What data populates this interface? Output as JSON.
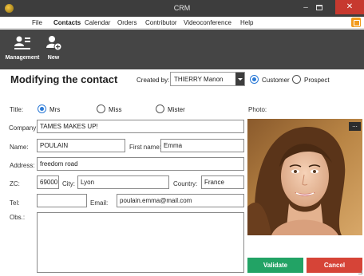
{
  "window": {
    "title": "CRM",
    "minimize_glyph": "–",
    "close_glyph": "✕"
  },
  "menu": {
    "items": [
      "File",
      "Contacts",
      "Calendar",
      "Orders",
      "Contributor",
      "Videoconference",
      "Help"
    ],
    "active": "Contacts"
  },
  "ribbon": {
    "management_label": "Management",
    "new_label": "New"
  },
  "header": {
    "title": "Modifying the contact",
    "created_by_label": "Created by:",
    "created_by_value": "THIERRY Manon",
    "customer_label": "Customer",
    "prospect_label": "Prospect",
    "type_selected": "Customer"
  },
  "form": {
    "title_label": "Title:",
    "title_options": [
      "Mrs",
      "Miss",
      "Mister"
    ],
    "title_selected": "Mrs",
    "photo_label": "Photo:",
    "photo_menu": "...",
    "company_label": "Company:",
    "company": "TAMES MAKES UP!",
    "name_label": "Name:",
    "name": "POULAIN",
    "first_name_label": "First name:",
    "first_name": "Emma",
    "address_label": "Address:",
    "address": "freedom road",
    "zc_label": "ZC:",
    "zc": "69000",
    "city_label": "City:",
    "city": "Lyon",
    "country_label": "Country:",
    "country": "France",
    "tel_label": "Tel:",
    "tel": "",
    "email_label": "Email:",
    "email": "poulain.emma@mail.com",
    "obs_label": "Obs.:",
    "obs": ""
  },
  "actions": {
    "validate": "Validate",
    "cancel": "Cancel"
  },
  "colors": {
    "titlebar": "#3d3d3d",
    "ribbon": "#454545",
    "accent_blue": "#2a79d6",
    "validate_green": "#22a365",
    "cancel_red": "#d64437",
    "close_red": "#c7392f",
    "menu_square": "#f29b1d"
  }
}
